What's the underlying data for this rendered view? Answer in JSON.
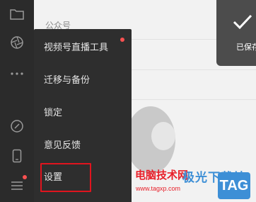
{
  "content": {
    "section_label": "公众号"
  },
  "toast": {
    "text": "已保存"
  },
  "menu": {
    "items": [
      {
        "label": "视频号直播工具"
      },
      {
        "label": "迁移与备份"
      },
      {
        "label": "锁定"
      },
      {
        "label": "意见反馈"
      },
      {
        "label": "设置"
      }
    ]
  },
  "watermark": {
    "site_red": "电脑技术网",
    "url": "www.tagxp.com",
    "site_blue": "极光下载站",
    "tag": "TAG"
  },
  "bottom_text": "...",
  "colors": {
    "sidebar_bg": "#2b2b2b",
    "menu_bg": "#2e2e2e",
    "notify_dot": "#fa5151",
    "highlight_border": "#e0141e"
  },
  "icons": [
    "folder-icon",
    "aperture-icon",
    "more-icon",
    "link-icon",
    "phone-icon",
    "menu-icon",
    "checkmark-icon"
  ]
}
